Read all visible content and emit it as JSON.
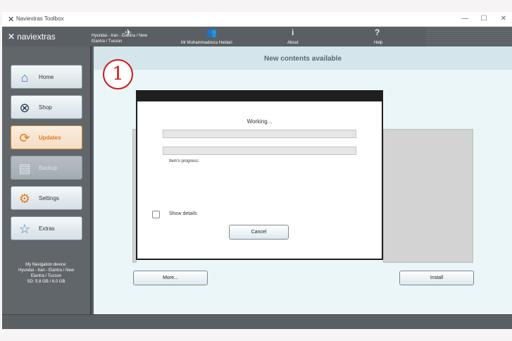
{
  "window": {
    "title": "Naviextras Toolbox",
    "controls": [
      "—",
      "☐",
      "✕"
    ]
  },
  "header": {
    "logo_text": "naviextras",
    "device_line1": "Hyundai - Iran - Elantra / New",
    "device_line2": "Elantra / Tucson",
    "user": "Mr Muhammadreza Heidari",
    "about": "About",
    "help": "Help"
  },
  "sidebar": {
    "items": [
      {
        "label": "Home",
        "icon": "home-icon",
        "state": "normal"
      },
      {
        "label": "Shop",
        "icon": "shop-icon",
        "state": "normal"
      },
      {
        "label": "Updates",
        "icon": "updates-icon",
        "state": "active"
      },
      {
        "label": "Backup",
        "icon": "backup-icon",
        "state": "disabled"
      },
      {
        "label": "Settings",
        "icon": "settings-icon",
        "state": "normal"
      },
      {
        "label": "Extras",
        "icon": "star-icon",
        "state": "normal"
      }
    ],
    "device_info": {
      "line1": "My Navigation device:",
      "line2": "Hyundai - Iran - Elantra / New",
      "line3": "Elantra / Tucson",
      "line4": "SD: 5.8 GB / 6.0 GB"
    }
  },
  "main": {
    "title": "New contents available",
    "more_button": "More...",
    "install_button": "Install"
  },
  "dialog": {
    "working": "Working...",
    "item_progress_label": "Item's progress:",
    "show_details": "Show details",
    "cancel": "Cancel",
    "overall_progress": 0,
    "item_progress": 0
  },
  "annotation": {
    "number": "1",
    "color": "#d01818"
  },
  "colors": {
    "accent": "#e07a20",
    "header": "#5a5f64",
    "content_bg": "#eaf6f8"
  }
}
